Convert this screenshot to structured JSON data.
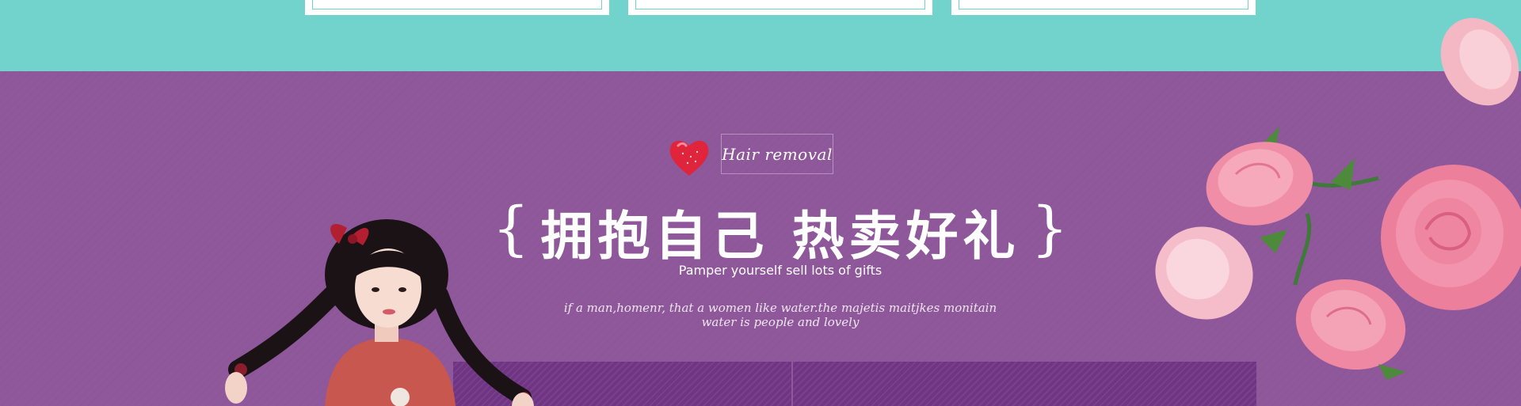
{
  "banner": {
    "tag_text": "Hair removal",
    "headline": "拥抱自己  热卖好礼",
    "brace_left": "{",
    "brace_right": "}",
    "subtitle": "Pamper yourself sell lots of gifts",
    "script_line_1": "if a man,homenr, that a women like water.the majetis maitjkes monitain",
    "script_line_2": "water is people and lovely"
  },
  "colors": {
    "teal": "#72d3cd",
    "purple": "#8f589b",
    "deep_purple": "#6e3582",
    "heart_red": "#e0243c",
    "rose_pink": "#f3a3b6"
  },
  "icons": {
    "heart": "heart-icon"
  }
}
